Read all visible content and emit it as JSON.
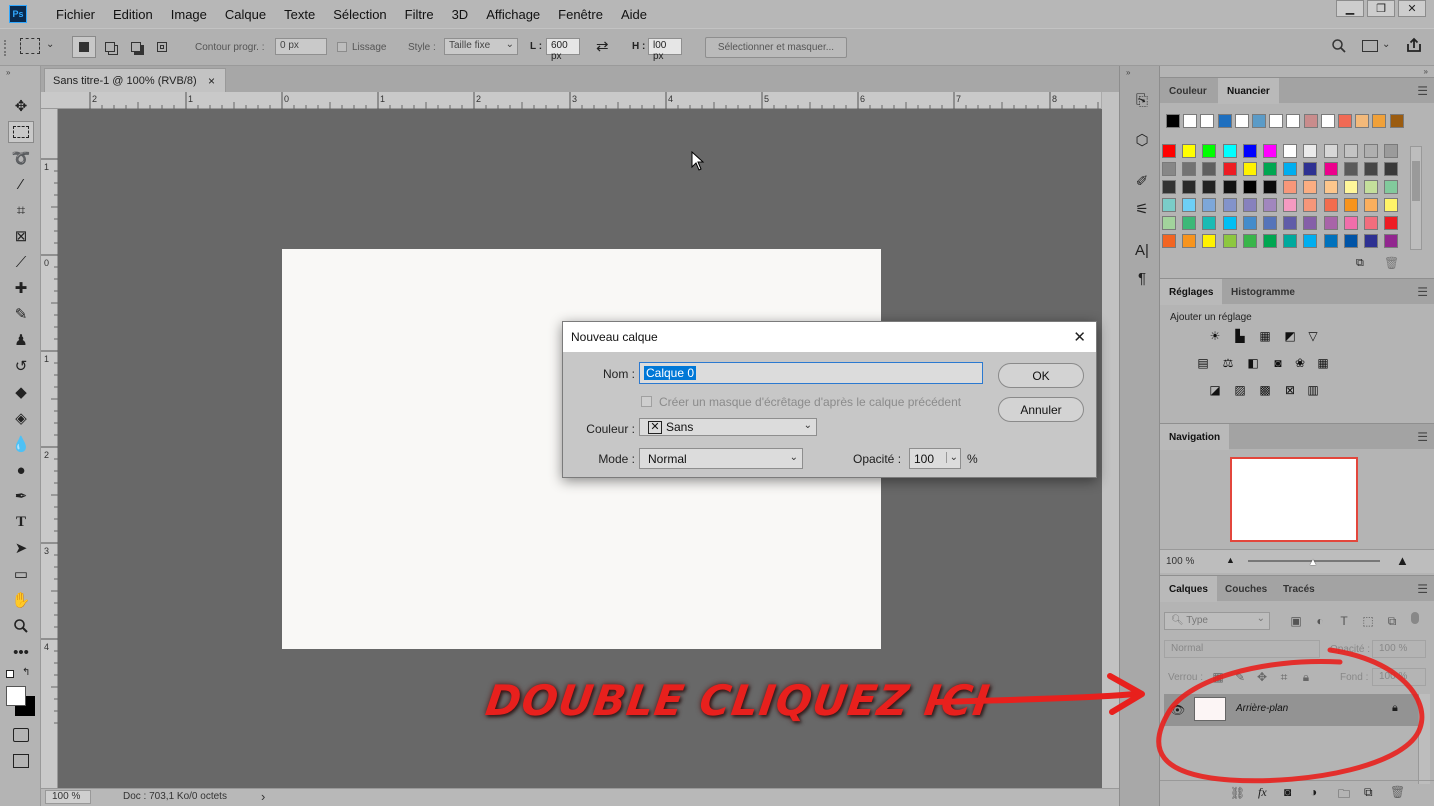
{
  "app": {
    "logo": "Ps"
  },
  "menu": [
    "Fichier",
    "Edition",
    "Image",
    "Calque",
    "Texte",
    "Sélection",
    "Filtre",
    "3D",
    "Affichage",
    "Fenêtre",
    "Aide"
  ],
  "window_controls": {
    "minimize": "▁",
    "restore": "❐",
    "close": "✕"
  },
  "options_bar": {
    "feather_label": "Contour progr. :",
    "feather_value": "0 px",
    "antialias_label": "Lissage",
    "style_label": "Style :",
    "style_value": "Taille fixe",
    "width_label": "L :",
    "width_value": "600 px",
    "height_label": "H :",
    "height_value": "l00 px",
    "select_mask_button": "Sélectionner et masquer..."
  },
  "document": {
    "tab_title": "Sans titre-1 @ 100% (RVB/8)",
    "tab_close": "×",
    "zoom": "100 %",
    "doc_info": "Doc : 703,1 Ko/0 octets",
    "status_arrow": "›",
    "ruler_top_labels": [
      "2",
      "1",
      "0",
      "1",
      "2",
      "3",
      "4",
      "5",
      "6",
      "7",
      "8"
    ],
    "ruler_left_labels": [
      "1",
      "0",
      "1",
      "2",
      "3",
      "4"
    ]
  },
  "dialog": {
    "title": "Nouveau calque",
    "close": "✕",
    "name_label": "Nom :",
    "name_value": "Calque 0",
    "clip_checkbox": "Créer un masque d'écrêtage d'après le calque précédent",
    "color_label": "Couleur :",
    "color_value": "Sans",
    "mode_label": "Mode :",
    "mode_value": "Normal",
    "opacity_label": "Opacité :",
    "opacity_value": "100",
    "opacity_unit": "%",
    "ok_button": "OK",
    "cancel_button": "Annuler"
  },
  "panels": {
    "color_tabs": [
      "Couleur",
      "Nuancier"
    ],
    "adjust_tabs": [
      "Réglages",
      "Histogramme"
    ],
    "adjust_hint": "Ajouter un réglage",
    "nav_tab": "Navigation",
    "nav_zoom": "100 %",
    "layers_tabs": [
      "Calques",
      "Couches",
      "Tracés"
    ],
    "layer_filter": "Type",
    "blend_mode": "Normal",
    "opacity_label": "Opacité :",
    "opacity_value": "100 %",
    "lock_label": "Verrou :",
    "fill_label": "Fond :",
    "fill_value": "100 %",
    "layer_name": "Arrière-plan"
  },
  "annotation": {
    "text": "DOUBLE CLIQUEZ ICI"
  },
  "colors": {
    "accent_blue": "#0078d7",
    "annotation_red": "#e8201d",
    "swatch_row1": [
      "#000000",
      "#ffffff",
      "#ffffff",
      "#1e6fbf",
      "#ffffff",
      "#5b9bc7",
      "#ffffff",
      "#ffffff",
      "#c98c8c",
      "#ffffff",
      "#f06a55",
      "#f3b97a",
      "#f0a13a",
      "#9b5c10"
    ],
    "swatch_grid": [
      [
        "#ff0000",
        "#ffff00",
        "#00ff00",
        "#00ffff",
        "#0000ff",
        "#ff00ff",
        "#ffffff",
        "#ebebeb",
        "#d7d7d7",
        "#c3c3c3",
        "#afafaf",
        "#9b9b9b"
      ],
      [
        "#878787",
        "#737373",
        "#5f5f5f",
        "#ed1c24",
        "#fff200",
        "#00a651",
        "#00aeef",
        "#2e3192",
        "#ec008c",
        "#5a5a5a",
        "#464646",
        "#3a3a3a"
      ],
      [
        "#333333",
        "#2a2a2a",
        "#222222",
        "#111111",
        "#000000",
        "#0a0a0a",
        "#f7977a",
        "#fbad82",
        "#fdc68c",
        "#fff79a",
        "#c4df9b",
        "#82ca9c"
      ],
      [
        "#7accc8",
        "#6dcff6",
        "#7da7d9",
        "#8393ca",
        "#8781bd",
        "#a186be",
        "#f49ac1",
        "#f69679",
        "#f26c4f",
        "#f7941d",
        "#fbaf5d",
        "#fff468"
      ],
      [
        "#a2d39c",
        "#3cb878",
        "#1abbb4",
        "#00bff3",
        "#448ccb",
        "#5674b9",
        "#605ca8",
        "#855fa8",
        "#a864a8",
        "#f06eaa",
        "#f26d7d",
        "#ed1c24"
      ],
      [
        "#f26522",
        "#f7941d",
        "#fff200",
        "#8dc73f",
        "#39b54a",
        "#00a651",
        "#00a99d",
        "#00aeef",
        "#0072bc",
        "#0054a6",
        "#2e3192",
        "#92278f"
      ]
    ]
  },
  "icons": {
    "tools": [
      "move-icon",
      "marquee-icon",
      "lasso-icon",
      "magic-wand-icon",
      "crop-icon",
      "frame-icon",
      "eyedropper-icon",
      "healing-icon",
      "brush-icon",
      "stamp-icon",
      "history-brush-icon",
      "eraser-icon",
      "paint-bucket-icon",
      "blur-icon",
      "dodge-icon",
      "pen-icon",
      "type-icon",
      "path-select-icon",
      "shape-icon",
      "hand-icon",
      "zoom-icon",
      "more-icon"
    ]
  }
}
